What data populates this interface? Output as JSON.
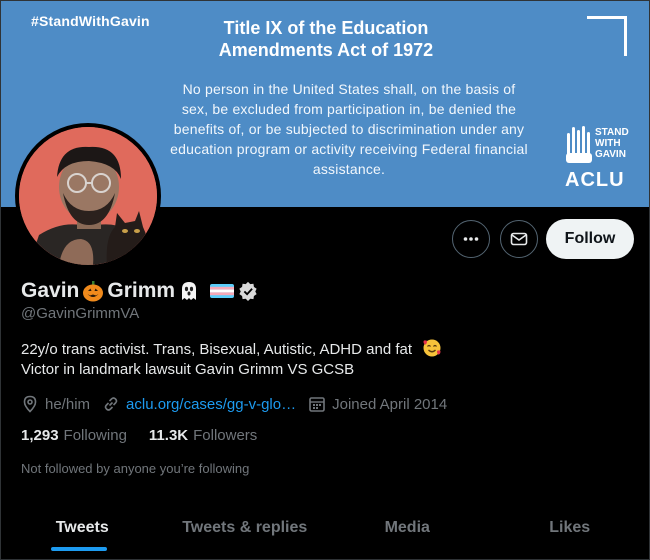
{
  "banner": {
    "hashtag": "#StandWithGavin",
    "title": "Title IX of the Education Amendments Act of 1972",
    "body": "No person in the United States shall, on the basis of sex, be excluded from participation in, be denied the benefits of, or be subjected to discrimination under any education program or activity receiving Federal financial assistance.",
    "logo_stand": "STAND\nWITH\nGAVIN",
    "logo_word": "ACLU",
    "color": "#4e8cc6"
  },
  "actions": {
    "more_icon": "more-icon",
    "message_icon": "envelope-icon",
    "follow_label": "Follow"
  },
  "profile": {
    "name_first": "Gavin",
    "name_last": "Grimm",
    "handle": "@GavinGrimmVA",
    "bio_line1": "22y/o trans activist. Trans, Bisexual, Autistic, ADHD and fat",
    "bio_line2": "Victor in landmark lawsuit Gavin Grimm VS GCSB",
    "pronouns": "he/him",
    "link": "aclu.org/cases/gg-v-glo…",
    "joined": "Joined April 2014",
    "following_count": "1,293",
    "following_label": "Following",
    "followers_count": "11.3K",
    "followers_label": "Followers",
    "not_followed": "Not followed by anyone you’re following"
  },
  "tabs": [
    {
      "label": "Tweets",
      "active": true
    },
    {
      "label": "Tweets & replies",
      "active": false
    },
    {
      "label": "Media",
      "active": false
    },
    {
      "label": "Likes",
      "active": false
    }
  ],
  "colors": {
    "accent": "#1d9bf0",
    "muted": "#71767b",
    "text": "#e7e9ea",
    "background": "#000000"
  }
}
